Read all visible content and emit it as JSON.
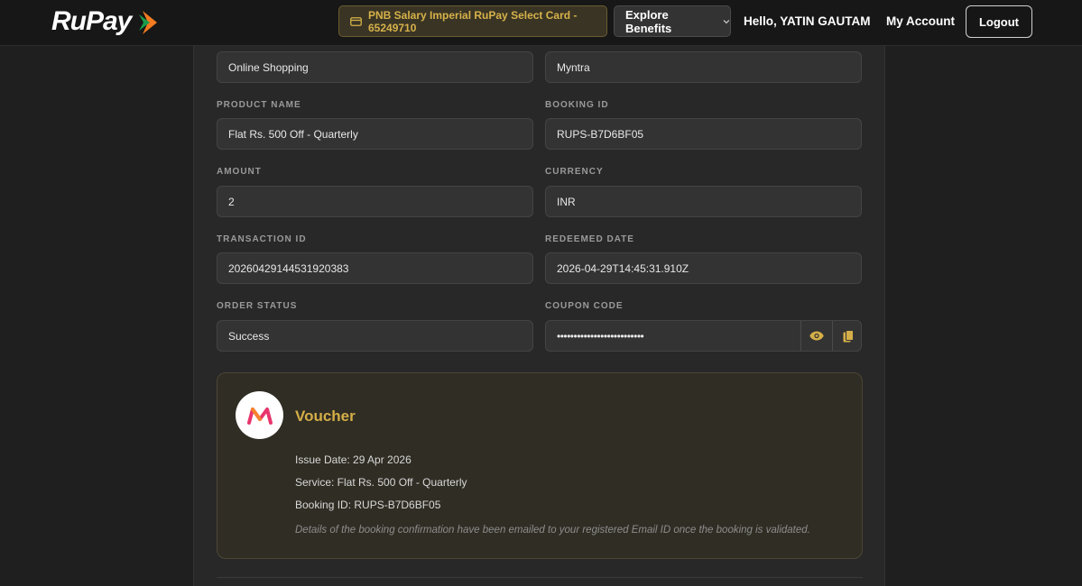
{
  "header": {
    "logo_text": "RuPay",
    "card_label": "PNB Salary Imperial RuPay Select Card - 65249710",
    "explore_label": "Explore Benefits",
    "greeting": "Hello, YATIN GAUTAM",
    "account_label": "My Account",
    "logout_label": "Logout"
  },
  "fields": {
    "category_value": "Online Shopping",
    "brand_value": "Myntra",
    "product_name": {
      "label": "PRODUCT NAME",
      "value": "Flat Rs. 500 Off - Quarterly"
    },
    "booking_id": {
      "label": "BOOKING ID",
      "value": "RUPS-B7D6BF05"
    },
    "amount": {
      "label": "AMOUNT",
      "value": "2"
    },
    "currency": {
      "label": "CURRENCY",
      "value": "INR"
    },
    "transaction_id": {
      "label": "TRANSACTION ID",
      "value": "20260429144531920383"
    },
    "redeemed_date": {
      "label": "REDEEMED DATE",
      "value": "2026-04-29T14:45:31.910Z"
    },
    "order_status": {
      "label": "ORDER STATUS",
      "value": "Success"
    },
    "coupon_code": {
      "label": "COUPON CODE",
      "value": "••••••••••••••••••••••••••"
    }
  },
  "voucher": {
    "title": "Voucher",
    "issue_date": "Issue Date: 29 Apr 2026",
    "service": "Service: Flat Rs. 500 Off - Quarterly",
    "booking": "Booking ID: RUPS-B7D6BF05",
    "note": "Details of the booking confirmation have been emailed to your registered Email ID once the booking is validated."
  },
  "icons": {
    "card": "credit-card-icon",
    "chevron": "chevron-down-icon",
    "eye": "eye-icon",
    "copy": "copy-icon",
    "brand": "myntra-logo"
  },
  "colors": {
    "accent_gold": "#d4ae48",
    "background": "#1f1f1f",
    "panel": "#282828"
  }
}
